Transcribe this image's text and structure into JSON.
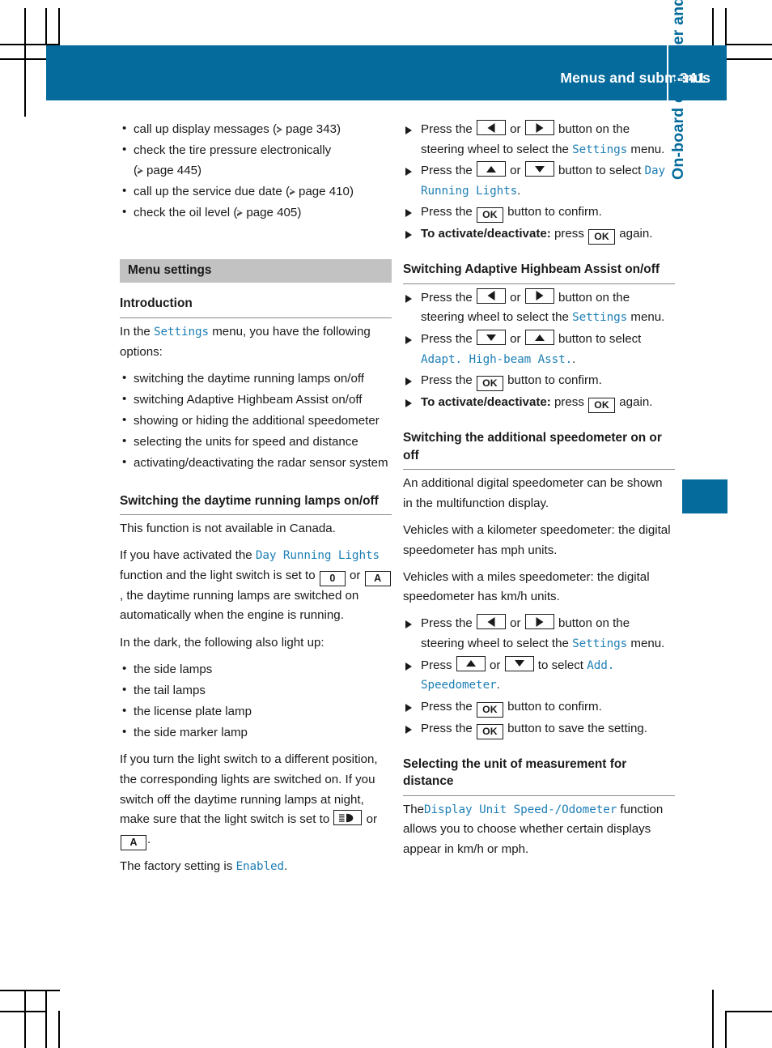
{
  "header": {
    "title": "Menus and submenus",
    "page_number": "341"
  },
  "chapter_tab": {
    "label": "On-board computer and displays",
    "accent_color": "#046b9c"
  },
  "left_column": {
    "intro_bullets": [
      {
        "text": "call up display messages",
        "ref": "page 343"
      },
      {
        "text": "check the tire pressure electronically",
        "ref": "page 445"
      },
      {
        "text": "call up the service due date",
        "ref": "page 410"
      },
      {
        "text": "check the oil level",
        "ref": "page 405"
      }
    ],
    "section_bar": "Menu settings",
    "introduction_heading": "Introduction",
    "intro_lead_before": "In the ",
    "intro_lead_menu": "Settings",
    "intro_lead_after": " menu, you have the following options:",
    "option_bullets": [
      "switching the daytime running lamps on/off",
      "switching Adaptive Highbeam Assist on/off",
      "showing or hiding the additional speedometer",
      "selecting the units for speed and distance",
      "activating/deactivating the radar sensor system"
    ],
    "drl_heading": "Switching the daytime running lamps on/off",
    "drl_p1": "This function is not available in Canada.",
    "drl_p2_a": "If you have activated the ",
    "drl_p2_menu": "Day Running Lights",
    "drl_p2_b": " function and the light switch is set to ",
    "drl_key_0": "0",
    "drl_or": " or ",
    "drl_key_a": "A",
    "drl_p2_c": ", the daytime running lamps are switched on automatically when the engine is running.",
    "drl_p3": "In the dark, the following also light up:",
    "drl_bullets": [
      "the side lamps",
      "the tail lamps",
      "the license plate lamp",
      "the side marker lamp"
    ],
    "drl_p4_a": "If you turn the light switch to a different position, the corresponding lights are switched on. If you switch off the daytime running lamps at night, make sure that the light switch is set to ",
    "drl_key_lamp_name": "low-beam-headlamp-icon",
    "drl_p4_b": " or ",
    "drl_key_a2": "A",
    "drl_p4_c": ".",
    "drl_p5_a": "The factory setting is ",
    "drl_p5_menu": "Enabled",
    "drl_p5_b": "."
  },
  "right_column": {
    "drl_steps": [
      {
        "prefix": "Press the ",
        "key1": "arrow-left",
        "mid": " or ",
        "key2": "arrow-right",
        "suffix_a": " button on the steering wheel to select the ",
        "menu": "Settings",
        "suffix_b": " menu."
      },
      {
        "prefix": "Press the ",
        "key1": "arrow-up",
        "mid": " or ",
        "key2": "arrow-down",
        "suffix_a": " button to select ",
        "menu": "Day Running Lights",
        "suffix_b": "."
      },
      {
        "prefix": "Press the ",
        "key1": "OK",
        "suffix_a": " button to confirm."
      },
      {
        "bold": "To activate/deactivate:",
        "prefix": " press ",
        "key1": "OK",
        "suffix_a": " again."
      }
    ],
    "ahba_heading": "Switching Adaptive Highbeam Assist on/off",
    "ahba_steps": [
      {
        "prefix": "Press the ",
        "key1": "arrow-left",
        "mid": " or ",
        "key2": "arrow-right",
        "suffix_a": " button on the steering wheel to select the ",
        "menu": "Settings",
        "suffix_b": " menu."
      },
      {
        "prefix": "Press the ",
        "key1": "arrow-down",
        "mid": " or ",
        "key2": "arrow-up",
        "suffix_a": " button to select ",
        "menu": "Adapt. High-beam Asst.",
        "suffix_b": "."
      },
      {
        "prefix": "Press the ",
        "key1": "OK",
        "suffix_a": " button to confirm."
      },
      {
        "bold": "To activate/deactivate:",
        "prefix": " press ",
        "key1": "OK",
        "suffix_a": " again."
      }
    ],
    "speedo_heading": "Switching the additional speedometer on or off",
    "speedo_p1": "An additional digital speedometer can be shown in the multifunction display.",
    "speedo_p2": "Vehicles with a kilometer speedometer: the digital speedometer has mph units.",
    "speedo_p3": "Vehicles with a miles speedometer: the digital speedometer has km/h units.",
    "speedo_steps": [
      {
        "prefix": "Press the ",
        "key1": "arrow-left",
        "mid": " or ",
        "key2": "arrow-right",
        "suffix_a": " button on the steering wheel to select the ",
        "menu": "Settings",
        "suffix_b": " menu."
      },
      {
        "prefix": "Press ",
        "key1": "arrow-up",
        "mid": " or ",
        "key2": "arrow-down",
        "suffix_a": " to select ",
        "menu": "Add. Speedometer",
        "suffix_b": "."
      },
      {
        "prefix": "Press the ",
        "key1": "OK",
        "suffix_a": " button to confirm."
      },
      {
        "prefix": "Press the ",
        "key1": "OK",
        "suffix_a": " button to save the setting."
      }
    ],
    "unit_heading": "Selecting the unit of measurement for distance",
    "unit_p_a": "The",
    "unit_p_menu": "Display Unit Speed-/Odometer",
    "unit_p_b": " function allows you to choose whether certain displays appear in km/h or mph."
  }
}
